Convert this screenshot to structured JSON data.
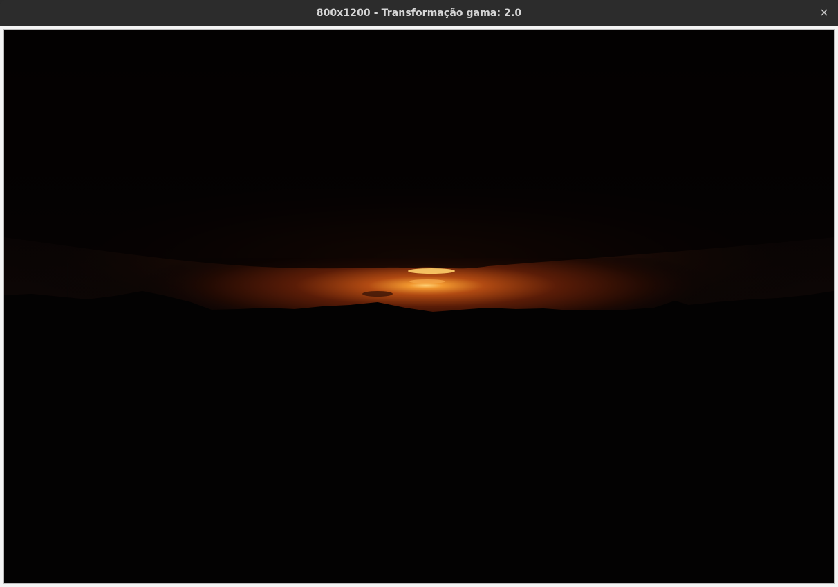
{
  "window": {
    "title": "800x1200 - Transformação gama: 2.0",
    "close_icon": "close-icon"
  },
  "image": {
    "subject": "sunset-silhouette-photo",
    "colors": {
      "sky_dark": "#050303",
      "cloud": "#1c0d07",
      "glow_core": "#f2a23a",
      "glow_mid": "#a8420f",
      "glow_outer": "#3a1306",
      "land": "#030202"
    }
  }
}
